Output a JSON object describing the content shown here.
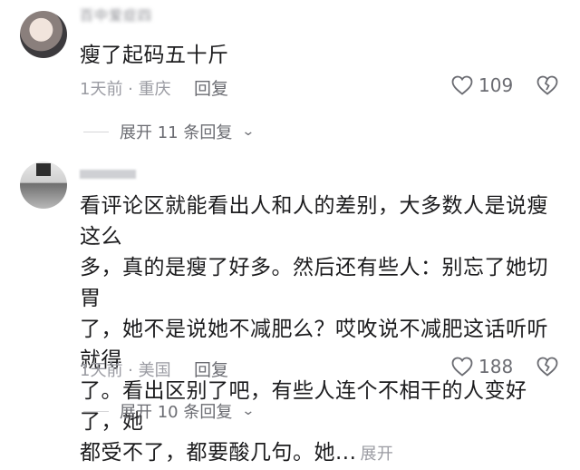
{
  "comments": [
    {
      "username": "百中爱症四",
      "text": "瘦了起码五十斤",
      "meta": "1天前 · 重庆",
      "reply_label": "回复",
      "likes": "109",
      "expand_label": "展开 11 条回复"
    },
    {
      "username": "",
      "text": "看评论区就能看出人和人的差别，大多数人是说瘦这么多，真的是瘦了好多。然后还有些人：别忘了她切胃了，她不是说她不减肥么？哎呚说不减肥这话听听就得了。看出区别了吧，有些人连个不相干的人变好了，她都受不了，都要酸几句。她...",
      "text_lines": [
        "看评论区就能看出人和人的差别，大多数人是说瘦这么",
        "多，真的是瘦了好多。然后还有些人：别忘了她切胃",
        "了，她不是说她不减肥么？哎呚说不减肥这话听听就得",
        "了。看出区别了吧，有些人连个不相干的人变好了，她",
        "都受不了，都要酸几句。她..."
      ],
      "inline_expand": "展开",
      "meta": "1天前 · 美国",
      "reply_label": "回复",
      "likes": "188",
      "expand_label": "展开 10 条回复"
    }
  ],
  "icons": [
    "heart-icon",
    "broken-heart-icon",
    "chevron-down-icon"
  ]
}
